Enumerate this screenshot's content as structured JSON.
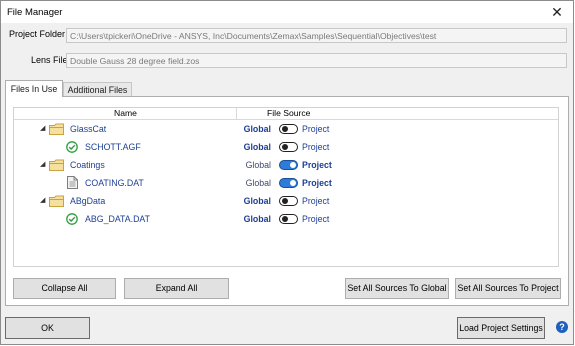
{
  "window": {
    "title": "File Manager",
    "close_glyph": "✕"
  },
  "fields": {
    "project_folder_label": "Project Folder",
    "project_folder_value": "C:\\Users\\tpickeri\\OneDrive - ANSYS, Inc\\Documents\\Zemax\\Samples\\Sequential\\Objectives\\test",
    "lens_file_label": "Lens File",
    "lens_file_value": "Double Gauss 28 degree field.zos"
  },
  "tabs": [
    {
      "label": "Files In Use",
      "active": true
    },
    {
      "label": "Additional Files",
      "active": false
    }
  ],
  "grid": {
    "col_name": "Name",
    "col_source": "File Source",
    "global_label": "Global",
    "project_label": "Project",
    "rows": [
      {
        "name": "GlassCat",
        "kind": "folder",
        "source": "Global"
      },
      {
        "name": "SCHOTT.AGF",
        "kind": "file-ok",
        "source": "Global"
      },
      {
        "name": "Coatings",
        "kind": "folder",
        "source": "Project"
      },
      {
        "name": "COATING.DAT",
        "kind": "file-doc",
        "source": "Project"
      },
      {
        "name": "ABgData",
        "kind": "folder",
        "source": "Global"
      },
      {
        "name": "ABG_DATA.DAT",
        "kind": "file-ok",
        "source": "Global"
      }
    ]
  },
  "buttons": {
    "collapse_all": "Collapse All",
    "expand_all": "Expand All",
    "set_all_global": "Set All Sources To Global",
    "set_all_project": "Set All Sources To Project",
    "ok": "OK",
    "load_project_settings": "Load Project Settings",
    "help": "?"
  },
  "icons": {
    "folder": "folder-icon",
    "check": "check-circle-icon",
    "document": "document-icon",
    "help": "help-icon"
  },
  "colors": {
    "link_blue": "#1c3f94",
    "toggle_on": "#2f7bd8",
    "check_green": "#2e9e3e",
    "folder_yellow": "#e8c15a",
    "help_blue": "#1f5fbf"
  }
}
